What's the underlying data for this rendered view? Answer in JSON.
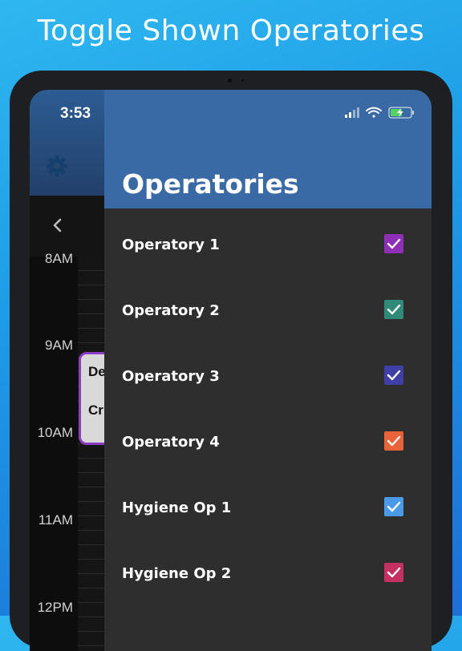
{
  "headline": "Toggle Shown Operatories",
  "status_bar": {
    "time": "3:53"
  },
  "timeline": {
    "hours": [
      "8AM",
      "9AM",
      "10AM",
      "11AM",
      "12PM"
    ],
    "appointment": {
      "line1": "De",
      "line2": "Cr",
      "border_color": "#8b3dc5"
    }
  },
  "drawer": {
    "title": "Operatories",
    "items": [
      {
        "label": "Operatory 1",
        "checked": true,
        "color": "#8e2fb8"
      },
      {
        "label": "Operatory 2",
        "checked": true,
        "color": "#2f8a78"
      },
      {
        "label": "Operatory 3",
        "checked": true,
        "color": "#3f3fa6"
      },
      {
        "label": "Operatory 4",
        "checked": true,
        "color": "#e8623a"
      },
      {
        "label": "Hygiene Op 1",
        "checked": true,
        "color": "#4a9ae8"
      },
      {
        "label": "Hygiene Op 2",
        "checked": true,
        "color": "#c53063"
      }
    ]
  },
  "icons": [
    "gear-icon",
    "chevron-left-icon",
    "cellular-signal-icon",
    "wifi-icon",
    "battery-charging-icon",
    "checkmark-icon"
  ]
}
